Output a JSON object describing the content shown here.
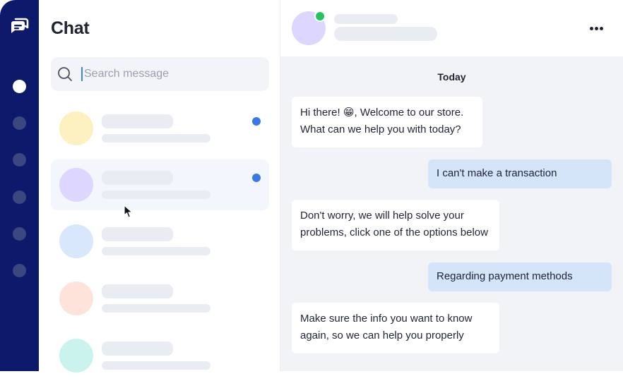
{
  "app": {
    "title": "Chat"
  },
  "rail": {
    "logo_icon": "chat-bubbles-icon",
    "nav_items": [
      {
        "icon": "nav-dot-icon",
        "active": true
      },
      {
        "icon": "nav-dot-icon",
        "active": false
      },
      {
        "icon": "nav-dot-icon",
        "active": false
      },
      {
        "icon": "nav-dot-icon",
        "active": false
      },
      {
        "icon": "nav-dot-icon",
        "active": false
      },
      {
        "icon": "nav-dot-icon",
        "active": false
      }
    ]
  },
  "search": {
    "icon": "search-icon",
    "placeholder": "Search message",
    "value": ""
  },
  "conversations": [
    {
      "avatar_color": "#fdf1c2",
      "unread": true,
      "selected": false
    },
    {
      "avatar_color": "#ddd6fe",
      "unread": true,
      "selected": true
    },
    {
      "avatar_color": "#d8e7fb",
      "unread": false,
      "selected": false
    },
    {
      "avatar_color": "#fde3d9",
      "unread": false,
      "selected": false
    },
    {
      "avatar_color": "#c9f3ec",
      "unread": false,
      "selected": false
    }
  ],
  "chat": {
    "contact_status": "online",
    "more_icon": "more-horizontal-icon",
    "day_label": "Today",
    "messages": [
      {
        "direction": "in",
        "lines": [
          "Hi there! 😁, Welcome to our store.",
          "What can we help you with today?"
        ]
      },
      {
        "direction": "out",
        "lines": [
          "I can't make a transaction"
        ]
      },
      {
        "direction": "in",
        "lines": [
          "Don't worry, we will help solve your",
          "problems, click one of the options below"
        ]
      },
      {
        "direction": "out",
        "lines": [
          "Regarding payment methods"
        ]
      },
      {
        "direction": "in",
        "lines": [
          "Make sure the info you want to know",
          "again, so we can help you properly"
        ]
      }
    ]
  },
  "colors": {
    "rail_background": "#0d1a6b",
    "accent": "#3b78e7",
    "outgoing_bubble": "#d4e5f9",
    "chat_background": "#f2f3f6",
    "online": "#22c55e"
  }
}
